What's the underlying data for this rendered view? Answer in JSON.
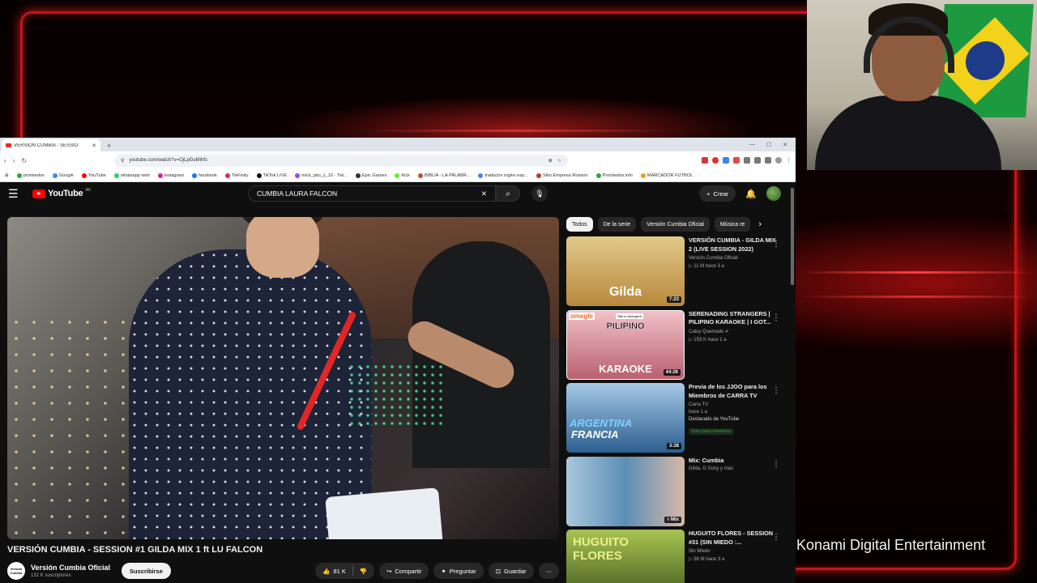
{
  "overlay": {
    "stream_text": "Konami Digital Entertainment"
  },
  "browser": {
    "tab_title": "VERSIÓN CUMBIA - SESSIO",
    "url": "youtube.com/watch?v=OjLpGuMihfs",
    "bookmarks": [
      "promiedos",
      "Google",
      "YouTube",
      "whatsapp web",
      "instagram",
      "facebook",
      "TikFinity",
      "TikTok LIVE",
      "mick_pitu_y_10 - Twi...",
      "Epic Games",
      "Kick",
      "BIBLIA - LA PALABR...",
      "traductor ingles esp...",
      "Sitio Empresa Rosario",
      "Promiedos.info",
      "MARCADOR FUTBOL"
    ]
  },
  "youtube": {
    "logo": "YouTube",
    "region": "AR",
    "search_query": "CUMBIA LAURA FALCON",
    "create_label": "Crear"
  },
  "video": {
    "title": "VERSIÓN CUMBIA - SESSION #1 GILDA MIX 1 ft LU FALCON",
    "channel_name": "Versión Cumbia Oficial",
    "channel_avatar_text": "Versión Cumbia",
    "subscribers": "132 K suscriptores",
    "subscribe_label": "Suscribirse",
    "likes": "81 K",
    "share_label": "Compartir",
    "ask_label": "Preguntar",
    "save_label": "Guardar"
  },
  "chips": [
    "Todos",
    "De la serie",
    "Versión Cumbia Oficial",
    "Música re"
  ],
  "recommendations": [
    {
      "title": "VERSIÓN CUMBIA - GILDA MIX 2 (LIVE SESSION 2022)",
      "channel": "Versión Cumbia Oficial",
      "stats": "▷ 11 M   hace 3 a",
      "duration": "7:23",
      "thumb_text": "Gilda",
      "thumb_color": "#c9a35a"
    },
    {
      "title": "SERENADING STRANGERS | PILIPINO KARAOKE | I GOT...",
      "channel": "Caloy Quemado",
      "stats": "▷ 159 K   hace 1 a",
      "duration": "44:26",
      "thumb_text_top": "PILIPINO",
      "thumb_text_bottom": "KARAOKE",
      "thumb_label": "omegle",
      "thumb_subtext": "Talk to strangers!",
      "thumb_color": "#c86b7e"
    },
    {
      "title": "Previa de los JJOO para los Miembros de CARRA TV",
      "channel": "Carra TV",
      "stats": "hace 1 a",
      "badge": "Destacado de YouTube",
      "members": "Solo para miembros",
      "duration": "3:28",
      "thumb_text_top": "ARGENTINA",
      "thumb_text_bottom": "FRANCIA",
      "thumb_color": "#4a82b8"
    },
    {
      "title": "Mix: Cumbia",
      "channel": "Gilda, G Sony y más",
      "duration": "Mix",
      "thumb_color": "#6fa6cc"
    },
    {
      "title": "HUGUITO FLORES - SESSION #31 (SIN MIEDO :...",
      "channel": "Sin Miedo",
      "stats": "▷ 56 M   hace 3 a",
      "thumb_text": "HUGUITO FLORES",
      "thumb_color": "#8fae3e"
    }
  ]
}
